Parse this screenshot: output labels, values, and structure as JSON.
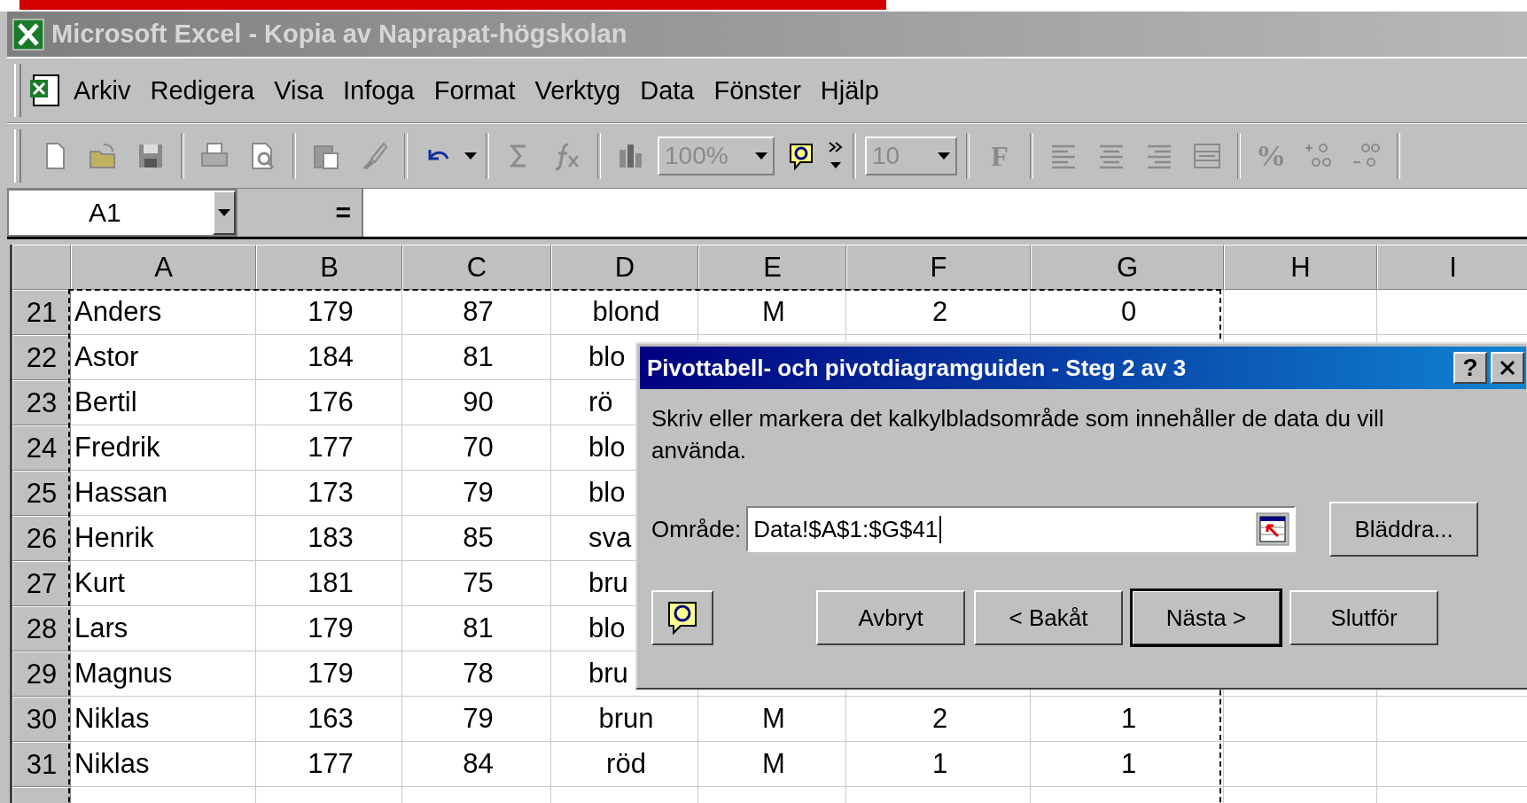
{
  "window": {
    "title": "Microsoft Excel - Kopia av Naprapat-högskolan"
  },
  "menu": [
    "Arkiv",
    "Redigera",
    "Visa",
    "Infoga",
    "Format",
    "Verktyg",
    "Data",
    "Fönster",
    "Hjälp"
  ],
  "toolbar": {
    "zoom": "100%",
    "font_size": "10",
    "bold": "F",
    "percent": "%"
  },
  "formula_bar": {
    "name_box": "A1",
    "equals": "="
  },
  "sheet": {
    "columns": [
      "A",
      "B",
      "C",
      "D",
      "E",
      "F",
      "G",
      "H",
      "I"
    ],
    "rows": [
      {
        "number": "21",
        "cells": [
          "Anders",
          "179",
          "87",
          "blond",
          "M",
          "2",
          "0"
        ]
      },
      {
        "number": "22",
        "cells": [
          "Astor",
          "184",
          "81",
          "blo"
        ]
      },
      {
        "number": "23",
        "cells": [
          "Bertil",
          "176",
          "90",
          "rö"
        ]
      },
      {
        "number": "24",
        "cells": [
          "Fredrik",
          "177",
          "70",
          "blo"
        ]
      },
      {
        "number": "25",
        "cells": [
          "Hassan",
          "173",
          "79",
          "blo"
        ]
      },
      {
        "number": "26",
        "cells": [
          "Henrik",
          "183",
          "85",
          "sva"
        ]
      },
      {
        "number": "27",
        "cells": [
          "Kurt",
          "181",
          "75",
          "bru"
        ]
      },
      {
        "number": "28",
        "cells": [
          "Lars",
          "179",
          "81",
          "blo"
        ]
      },
      {
        "number": "29",
        "cells": [
          "Magnus",
          "179",
          "78",
          "bru"
        ]
      },
      {
        "number": "30",
        "cells": [
          "Niklas",
          "163",
          "79",
          "brun",
          "M",
          "2",
          "1"
        ]
      },
      {
        "number": "31",
        "cells": [
          "Niklas",
          "177",
          "84",
          "röd",
          "M",
          "1",
          "1"
        ]
      }
    ]
  },
  "dialog": {
    "title": "Pivottabell- och pivotdiagramguiden - Steg 2 av 3",
    "help": "?",
    "message": "Skriv eller markera det kalkylbladsområde som innehåller de data du vill använda.",
    "range_label": "Område:",
    "range_value": "Data!$A$1:$G$41",
    "browse": "Bläddra...",
    "buttons": [
      {
        "label": "Avbryt",
        "default": false
      },
      {
        "label": "< Bakåt",
        "default": false
      },
      {
        "label": "Nästa >",
        "default": true
      },
      {
        "label": "Slutför",
        "default": false
      }
    ]
  }
}
